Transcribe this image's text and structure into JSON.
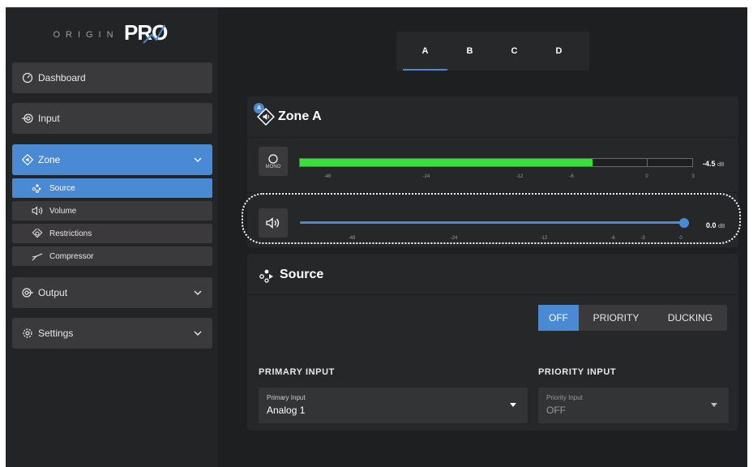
{
  "brand": {
    "origin": "ORIGIN",
    "pro": "PRO"
  },
  "sidebar": {
    "items": [
      {
        "label": "Dashboard",
        "icon": "dashboard-icon"
      },
      {
        "label": "Input",
        "icon": "input-icon"
      },
      {
        "label": "Zone",
        "icon": "zone-icon",
        "active": true,
        "expanded": true,
        "subitems": [
          {
            "label": "Source",
            "icon": "source-icon",
            "active": true
          },
          {
            "label": "Volume",
            "icon": "volume-icon"
          },
          {
            "label": "Restrictions",
            "icon": "restrictions-icon"
          },
          {
            "label": "Compressor",
            "icon": "compressor-icon"
          }
        ]
      },
      {
        "label": "Output",
        "icon": "output-icon"
      },
      {
        "label": "Settings",
        "icon": "settings-icon"
      }
    ]
  },
  "tabs": [
    {
      "label": "A",
      "active": true
    },
    {
      "label": "B"
    },
    {
      "label": "C"
    },
    {
      "label": "D"
    }
  ],
  "zone": {
    "title": "Zone A",
    "badge": "A",
    "mono_label": "MONO",
    "meter": {
      "level_fraction": 0.745,
      "readout": "-4.5",
      "unit": "dB",
      "ticks": [
        "-48",
        "-24",
        "-12",
        "-6",
        "0",
        "3"
      ]
    },
    "fader": {
      "level_fraction": 1.0,
      "readout": "0.0",
      "unit": "dB",
      "ticks": [
        "-48",
        "-24",
        "-12",
        "-6",
        "-3",
        "0"
      ]
    }
  },
  "source": {
    "title": "Source",
    "modes": [
      {
        "label": "OFF",
        "active": true
      },
      {
        "label": "PRIORITY"
      },
      {
        "label": "DUCKING"
      }
    ],
    "primary": {
      "heading": "PRIMARY INPUT",
      "field_label": "Primary Input",
      "value": "Analog 1"
    },
    "priority": {
      "heading": "PRIORITY INPUT",
      "field_label": "Priority Input",
      "value": "OFF",
      "disabled": true
    }
  },
  "colors": {
    "accent": "#4a8ad4",
    "meter_green": "#3ddc3d",
    "background": "#1e1f21",
    "panel": "#262729"
  }
}
